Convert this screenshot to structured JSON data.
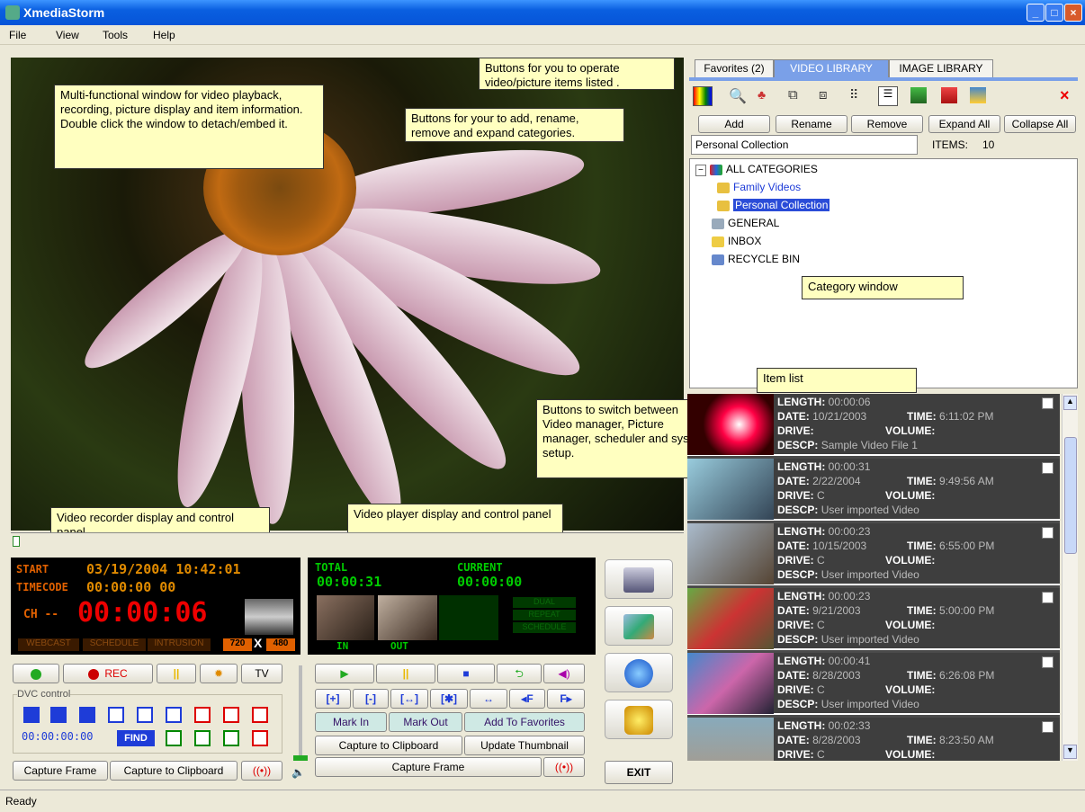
{
  "window": {
    "title": "XmediaStorm"
  },
  "menu": [
    "File",
    "View",
    "Tools",
    "Help"
  ],
  "callouts": {
    "video_window": "Multi-functional window for video playback, recording, picture display and item information. Double click the window to detach/embed it.",
    "item_buttons": "Buttons for you to operate video/picture items listed .",
    "category_buttons": "Buttons for your to add, rename, remove and expand categories.",
    "category_window": "Category window",
    "item_list": "Item list",
    "switch_buttons": "Buttons to switch between Video manager, Picture manager, scheduler and system setup.",
    "recorder": "Video recorder display and control panel",
    "player": "Video player display and control panel"
  },
  "recorder": {
    "start_label": "START",
    "start_value": "03/19/2004 10:42:01",
    "timecode_label": "TIMECODE",
    "timecode_value": "00:00:00 00",
    "ch_label": "CH --",
    "elapsed": "00:00:06",
    "webcast": "WEBCAST",
    "schedule": "SCHEDULE",
    "intrusion": "INTRUSION",
    "width": "720",
    "x": "X",
    "height": "480",
    "rec_label": "REC",
    "tv_label": "TV",
    "dvc_label": "DVC control",
    "dvc_time": [
      "00",
      "00",
      "00",
      "00"
    ],
    "find_label": "FIND",
    "capture_frame": "Capture Frame",
    "capture_clipboard": "Capture to Clipboard"
  },
  "player": {
    "total_label": "TOTAL",
    "total_value": "00:00:31",
    "current_label": "CURRENT",
    "current_value": "00:00:00",
    "dual": "DUAL",
    "repeat": "REPEAT",
    "schedule": "SCHEDULE",
    "in_label": "IN",
    "out_label": "OUT",
    "mark_in": "Mark In",
    "mark_out": "Mark Out",
    "add_favorites": "Add To Favorites",
    "capture_clipboard": "Capture to Clipboard",
    "update_thumbnail": "Update Thumbnail",
    "capture_frame": "Capture Frame",
    "edit_buttons": [
      "[+]",
      "[-]",
      "[↔]",
      "[✱]",
      "↔",
      "◂F",
      "F▸"
    ]
  },
  "exit_label": "EXIT",
  "tabs": [
    "Favorites (2)",
    "VIDEO LIBRARY",
    "IMAGE LIBRARY"
  ],
  "category_buttons": [
    "Add",
    "Rename",
    "Remove",
    "Expand All",
    "Collapse All"
  ],
  "selected_category": "Personal Collection",
  "items_label": "ITEMS:",
  "items_count": "10",
  "tree": [
    "ALL CATEGORIES",
    "Family Videos",
    "Personal Collection",
    "GENERAL",
    "INBOX",
    "RECYCLE BIN"
  ],
  "field_labels": {
    "length": "LENGTH:",
    "date": "DATE:",
    "time": "TIME:",
    "drive": "DRIVE:",
    "volume": "VOLUME:",
    "descp": "DESCP:"
  },
  "items": [
    {
      "length": "00:00:06",
      "date": "10/21/2003",
      "time": "6:11:02 PM",
      "drive": "",
      "descp": "Sample Video File 1"
    },
    {
      "length": "00:00:31",
      "date": "2/22/2004",
      "time": "9:49:56 AM",
      "drive": "C",
      "descp": "User imported Video"
    },
    {
      "length": "00:00:23",
      "date": "10/15/2003",
      "time": "6:55:00 PM",
      "drive": "C",
      "descp": "User imported Video"
    },
    {
      "length": "00:00:23",
      "date": "9/21/2003",
      "time": "5:00:00 PM",
      "drive": "C",
      "descp": "User imported Video"
    },
    {
      "length": "00:00:41",
      "date": "8/28/2003",
      "time": "6:26:08 PM",
      "drive": "C",
      "descp": "User imported Video"
    },
    {
      "length": "00:02:33",
      "date": "8/28/2003",
      "time": "8:23:50 AM",
      "drive": "C",
      "descp": "User imported Video"
    }
  ],
  "status": "Ready"
}
